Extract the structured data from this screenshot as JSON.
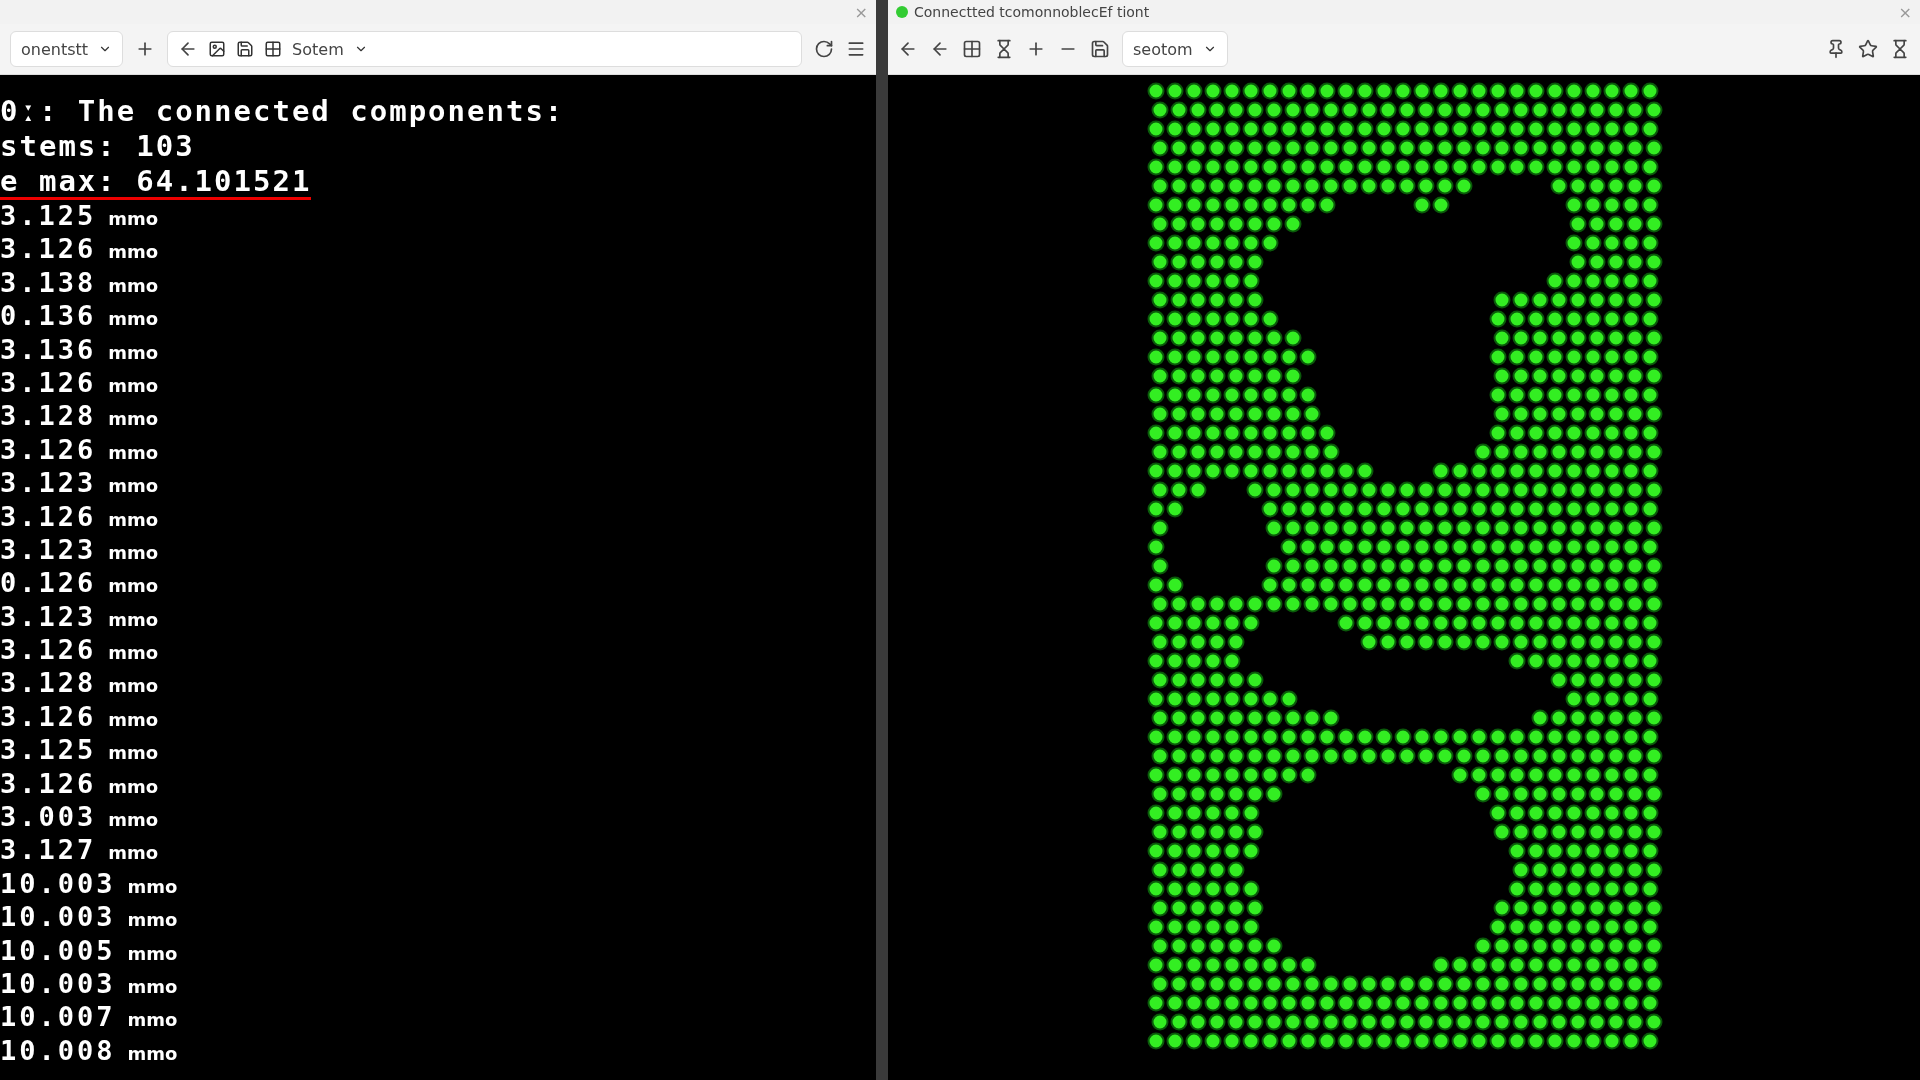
{
  "left_window": {
    "close": "×",
    "address": {
      "tab_label": "onentstt",
      "path_text": "Sotem"
    },
    "terminal": {
      "header_lines": [
        {
          "text": "0ː: The connected components:",
          "underlined": false
        },
        {
          "text": "stems: 103",
          "underlined": false
        },
        {
          "text": "e max: 64.101521",
          "underlined": true
        }
      ],
      "rows": [
        {
          "value": "3.125",
          "unit": "mmo"
        },
        {
          "value": "3.126",
          "unit": "mmo"
        },
        {
          "value": "3.138",
          "unit": "mmo"
        },
        {
          "value": "0.136",
          "unit": "mmo"
        },
        {
          "value": "3.136",
          "unit": "mmo"
        },
        {
          "value": "3.126",
          "unit": "mmo"
        },
        {
          "value": "3.128",
          "unit": "mmo"
        },
        {
          "value": "3.126",
          "unit": "mmo"
        },
        {
          "value": "3.123",
          "unit": "mmo"
        },
        {
          "value": "3.126",
          "unit": "mmo"
        },
        {
          "value": "3.123",
          "unit": "mmo"
        },
        {
          "value": "0.126",
          "unit": "mmo"
        },
        {
          "value": "3.123",
          "unit": "mmo"
        },
        {
          "value": "3.126",
          "unit": "mmo"
        },
        {
          "value": "3.128",
          "unit": "mmo"
        },
        {
          "value": "3.126",
          "unit": "mmo"
        },
        {
          "value": "3.125",
          "unit": "mmo"
        },
        {
          "value": "3.126",
          "unit": "mmo"
        },
        {
          "value": "3.003",
          "unit": "mmo"
        },
        {
          "value": "3.127",
          "unit": "mmo"
        },
        {
          "value": "10.003",
          "unit": "mmo"
        },
        {
          "value": "10.003",
          "unit": "mmo"
        },
        {
          "value": "10.005",
          "unit": "mmo"
        },
        {
          "value": "10.003",
          "unit": "mmo"
        },
        {
          "value": "10.007",
          "unit": "mmo"
        },
        {
          "value": "10.008",
          "unit": "mmo"
        }
      ]
    }
  },
  "right_window": {
    "title": "Connectted tcomonnoblecEf tiont",
    "close": "×",
    "toolbar_text": "seotom"
  }
}
